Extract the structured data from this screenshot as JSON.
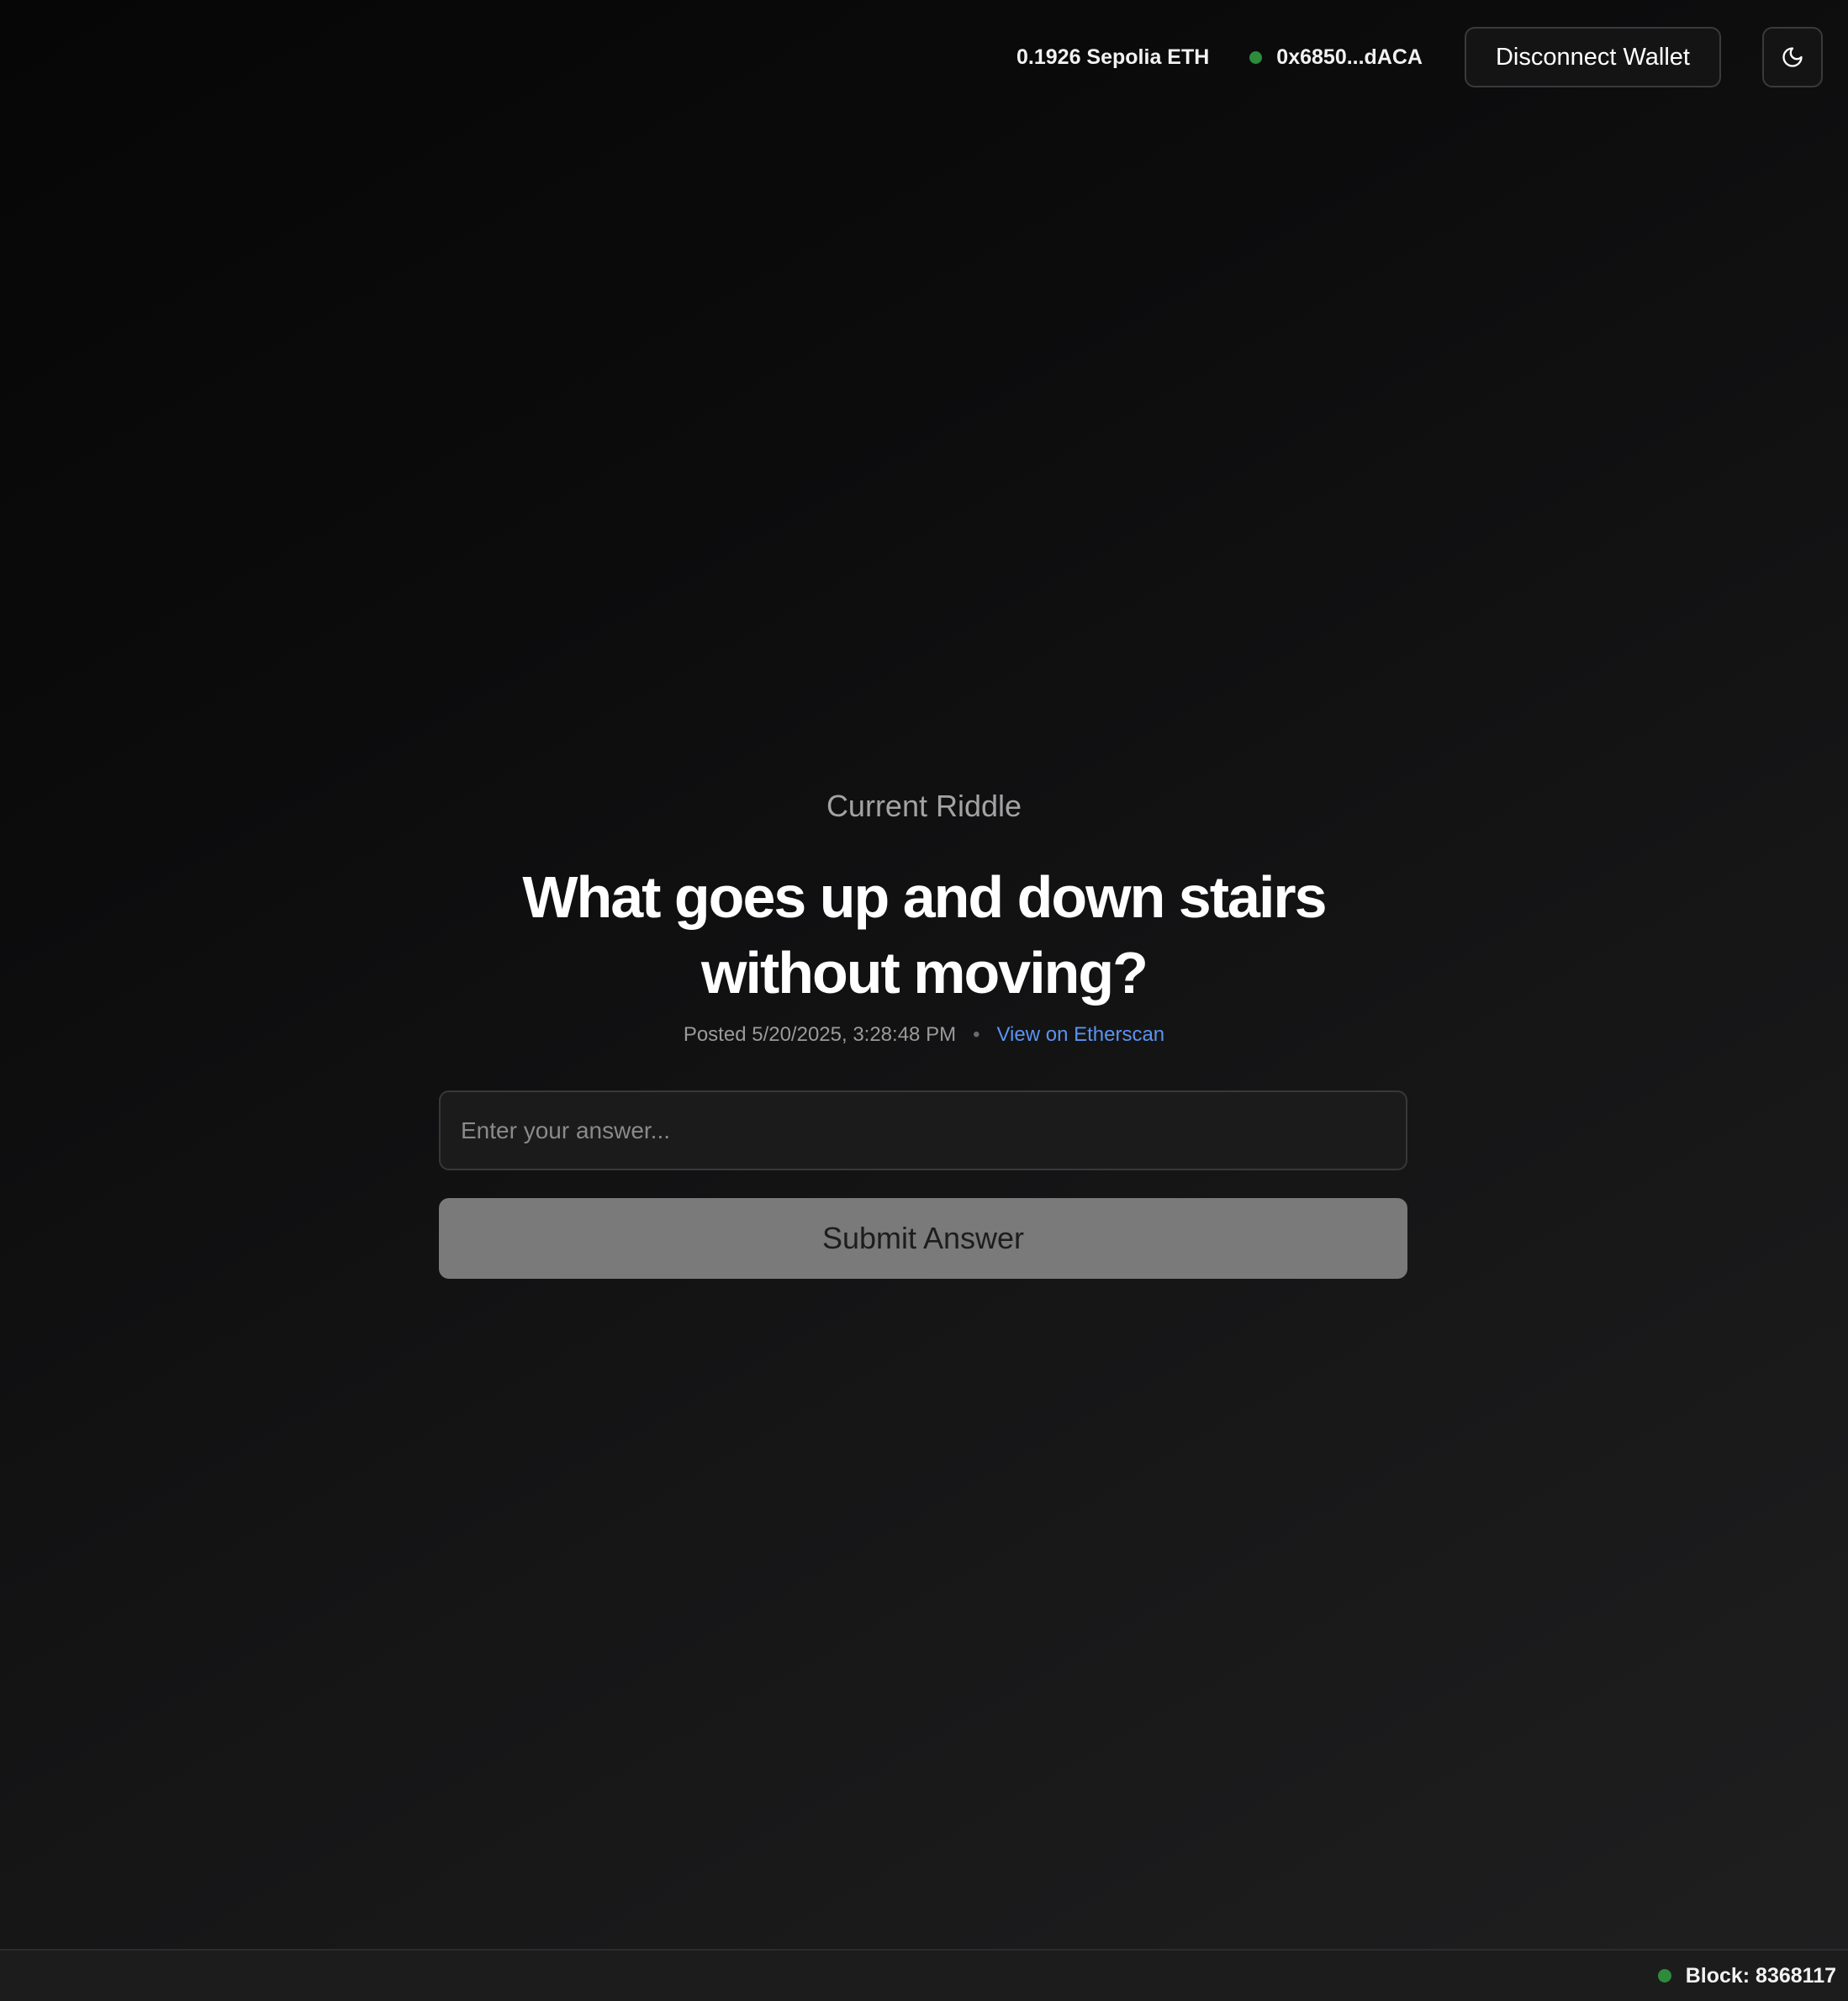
{
  "header": {
    "balance": "0.1926 Sepolia ETH",
    "wallet_address": "0x6850...dACA",
    "disconnect_label": "Disconnect Wallet",
    "theme_icon": "moon-icon"
  },
  "riddle": {
    "label": "Current Riddle",
    "question": "What goes up and down stairs without moving?",
    "posted": "Posted 5/20/2025, 3:28:48 PM",
    "separator": "•",
    "etherscan_link": "View on Etherscan"
  },
  "answer": {
    "placeholder": "Enter your answer...",
    "value": "",
    "submit_label": "Submit Answer"
  },
  "footer": {
    "block": "Block: 8368117"
  },
  "colors": {
    "status_green": "#2e8b3c",
    "link_blue": "#5b93f0",
    "submit_bg": "#7a7a7a"
  }
}
